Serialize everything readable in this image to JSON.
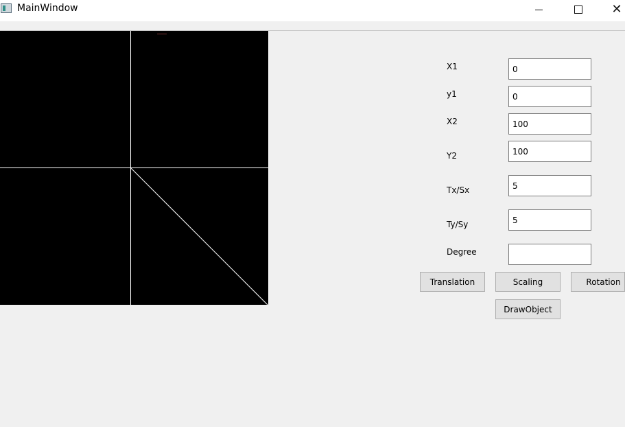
{
  "window": {
    "title": "MainWindow",
    "close_glyph": "✕"
  },
  "form": {
    "x1_label": "X1",
    "x1_value": "0",
    "y1_label": "y1",
    "y1_value": "0",
    "x2_label": "X2",
    "x2_value": "100",
    "y2_label": "Y2",
    "y2_value": "100",
    "tx_label": "Tx/Sx",
    "tx_value": "5",
    "ty_label": "Ty/Sy",
    "ty_value": "5",
    "degree_label": "Degree",
    "degree_value": ""
  },
  "buttons": {
    "translation": "Translation",
    "scaling": "Scaling",
    "rotation": "Rotation",
    "draw": "DrawObject"
  },
  "colors": {
    "canvas_bg": "#000000",
    "axis": "#ffffff",
    "window_bg": "#f0f0f0"
  }
}
